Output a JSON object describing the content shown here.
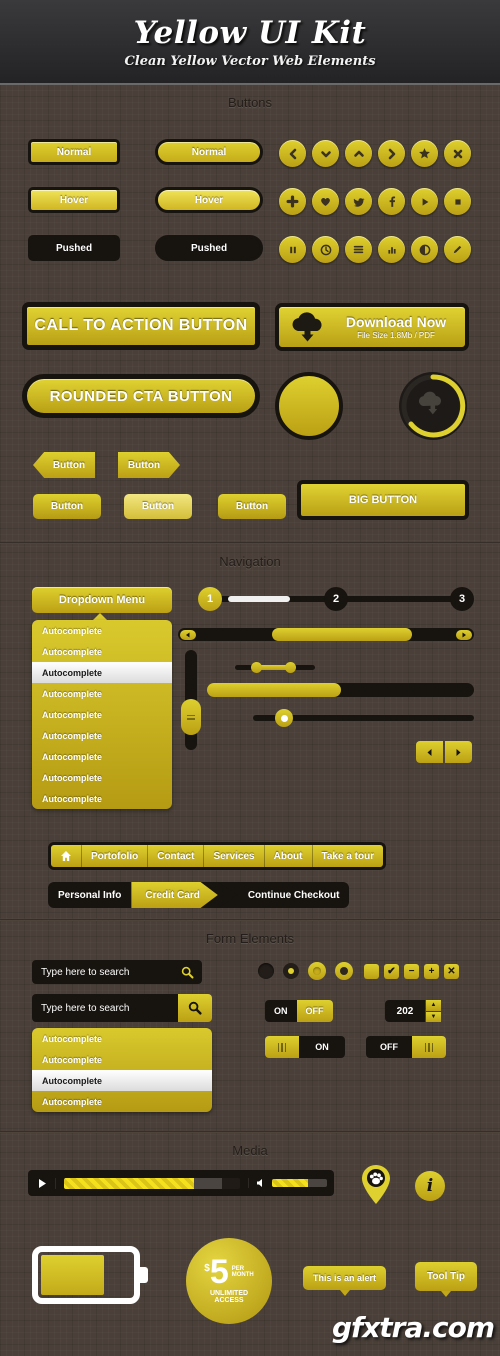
{
  "header": {
    "title": "Yellow UI Kit",
    "subtitle": "Clean Yellow Vector Web Elements"
  },
  "sections": {
    "buttons": "Buttons",
    "navigation": "Navigation",
    "form": "Form Elements",
    "media": "Media"
  },
  "buttons": {
    "states": [
      "Normal",
      "Hover",
      "Pushed"
    ],
    "icons_row1": [
      "chevron-left",
      "chevron-down",
      "chevron-up",
      "chevron-right",
      "star",
      "close"
    ],
    "icons_row2": [
      "plus",
      "heart",
      "twitter",
      "facebook",
      "play",
      "stop"
    ],
    "icons_row3": [
      "pause",
      "clock",
      "menu",
      "chart",
      "contrast",
      "pencil"
    ],
    "cta": "CALL TO ACTION BUTTON",
    "cta_rounded": "ROUNDED CTA BUTTON",
    "download_title": "Download Now",
    "download_sub": "File Size 1.8Mb / PDF",
    "small": [
      "Button",
      "Button",
      "Button",
      "Button",
      "Button"
    ],
    "big": "BIG BUTTON"
  },
  "navigation": {
    "dropdown": "Dropdown Menu",
    "autocomplete_items": [
      "Autocomplete",
      "Autocomplete",
      "Autocomplete",
      "Autocomplete",
      "Autocomplete",
      "Autocomplete",
      "Autocomplete",
      "Autocomplete",
      "Autocomplete"
    ],
    "autocomplete_selected_index": 2,
    "steps": [
      "1",
      "2",
      "3"
    ],
    "active_step": "1",
    "navbar": [
      "Portofolio",
      "Contact",
      "Services",
      "About",
      "Take a tour"
    ],
    "navbar_home_icon": "home-icon",
    "breadcrumb": [
      "Personal Info",
      "Credit Card",
      "Continue Checkout"
    ],
    "breadcrumb_active": "Credit Card",
    "prev_icon": "triangle-left-icon",
    "next_icon": "triangle-right-icon"
  },
  "form": {
    "search_placeholder": "Type here to search",
    "search_icon": "magnifier-icon",
    "autocomplete_items": [
      "Autocomplete",
      "Autocomplete",
      "Autocomplete",
      "Autocomplete"
    ],
    "autocomplete_selected_index": 2,
    "checkbox_glyphs": [
      "",
      "✔",
      "−",
      "+",
      "✕"
    ],
    "toggle_on": "ON",
    "toggle_off": "OFF",
    "spinner_value": "202"
  },
  "media": {
    "play_icon": "play-icon",
    "volume_icon": "speaker-icon",
    "pin_icon": "map-pin-paw-icon",
    "info_icon": "info-icon",
    "battery_icon": "battery-icon",
    "price_currency": "$",
    "price_amount": "5",
    "price_per": "PER",
    "price_period": "MONTH",
    "price_line1": "UNLIMITED",
    "price_line2": "ACCESS",
    "alert": "This is an alert",
    "tooltip": "Tool Tip"
  },
  "watermark": "gfxtra.com",
  "colors": {
    "yellow": "#ded02f",
    "yellow_dark": "#bba014",
    "dark": "#17130f",
    "bg": "#4a4039"
  }
}
